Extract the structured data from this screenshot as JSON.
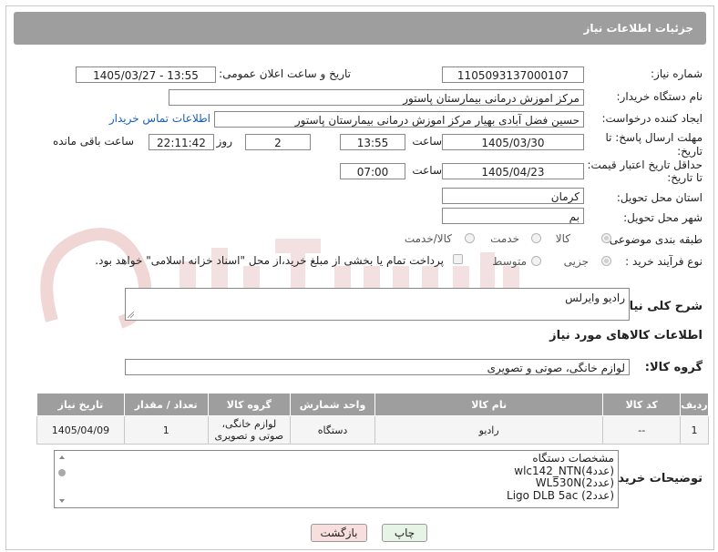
{
  "header": {
    "title": "جزئیات اطلاعات نیاز"
  },
  "fields": {
    "need_number": {
      "label": "شماره نیاز:",
      "value": "1105093137000107"
    },
    "announce_datetime": {
      "label": "تاریخ و ساعت اعلان عمومی:",
      "value": "1405/03/27 - 13:55"
    },
    "buyer_org": {
      "label": "نام دستگاه خریدار:",
      "value": "مرکز اموزش درمانی بیمارستان پاستور"
    },
    "requester": {
      "label": "ایجاد کننده درخواست:",
      "value": "حسین فضل آبادی بهیار مرکز اموزش درمانی بیمارستان پاستور",
      "contact_link": "اطلاعات تماس خریدار"
    },
    "reply_deadline": {
      "label_line1": "مهلت ارسال پاسخ: تا",
      "label_line2": "تاریخ:",
      "date": "1405/03/30",
      "time_label": "ساعت",
      "time": "13:55",
      "days": "2",
      "days_label": "روز و",
      "remaining": "22:11:42",
      "remaining_label": "ساعت باقی مانده"
    },
    "price_validity": {
      "label_line1": "حداقل تاریخ اعتبار قیمت:",
      "label_line2": "تا تاریخ:",
      "date": "1405/04/23",
      "time_label": "ساعت",
      "time": "07:00"
    },
    "province": {
      "label": "استان محل تحویل:",
      "value": "کرمان"
    },
    "city": {
      "label": "شهر محل تحویل:",
      "value": "بم"
    },
    "category": {
      "label": "طبقه بندی موضوعی:",
      "options": [
        "کالا",
        "خدمت",
        "کالا/خدمت"
      ],
      "selected": "کالا"
    },
    "purchase_type": {
      "label": "نوع فرآیند خرید :",
      "options": [
        "جزیی",
        "متوسط"
      ],
      "selected": "جزیی",
      "treasury_note": "پرداخت تمام یا بخشی از مبلغ خرید،از محل \"اسناد خزانه اسلامی\" خواهد بود."
    }
  },
  "description": {
    "label": "شرح کلی نیاز:",
    "value": "رادیو وایرلس"
  },
  "goods_info": {
    "heading": "اطلاعات کالاهای مورد نیاز"
  },
  "goods_group": {
    "label": "گروه کالا:",
    "value": "لوازم خانگی، صوتی و تصویری"
  },
  "table": {
    "headers": [
      "ردیف",
      "کد کالا",
      "نام کالا",
      "واحد شمارش",
      "گروه کالا",
      "تعداد / مقدار",
      "تاریخ نیاز"
    ],
    "rows": [
      {
        "row": "1",
        "code": "--",
        "name": "رادیو",
        "unit": "دستگاه",
        "group_line1": "لوازم خانگی،",
        "group_line2": "صوتی و تصویری",
        "qty": "1",
        "date": "1405/04/09"
      }
    ]
  },
  "buyer_notes": {
    "label": "توضیحات خریدار:",
    "lines": [
      "مشخصات دستگاه",
      "wlc142_NTN(4عدد)",
      "WL530N(2عدد)",
      "Ligo DLB 5ac (2عدد)"
    ]
  },
  "buttons": {
    "print": "چاپ",
    "back": "بازگشت"
  },
  "colors": {
    "header_bg": "#9e9e9e",
    "link": "#1a5fb4",
    "print_bg": "#e6f4e6",
    "back_bg": "#f9dede"
  }
}
